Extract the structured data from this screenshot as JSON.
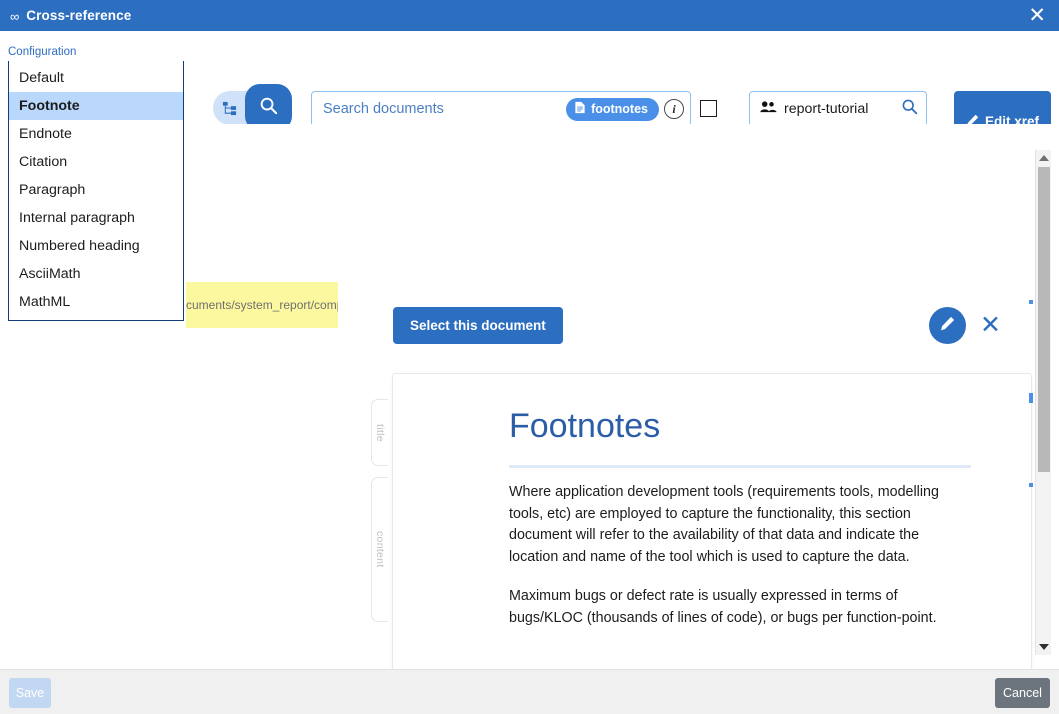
{
  "window": {
    "title": "Cross-reference",
    "icon": "link-infinity-icon",
    "close_label": "✕"
  },
  "toolbar": {
    "config_label": "Configuration",
    "config_value": "Footnote",
    "config_options": [
      "Default",
      "Footnote",
      "Endnote",
      "Citation",
      "Paragraph",
      "Internal paragraph",
      "Numbered heading",
      "AsciiMath",
      "MathML"
    ],
    "config_selected_index": 1,
    "tree_button_name": "document-tree-icon",
    "search_button_name": "search-icon",
    "search_placeholder": "Search documents",
    "search_value": "",
    "chip_label": "footnotes",
    "info_label": "i",
    "project_value": "report-tutorial",
    "edit_xref_label": "Edit xref"
  },
  "main": {
    "highlight_path": "cuments/system_report/comp",
    "select_document_label": "Select this document",
    "section_tags": [
      "title",
      "content"
    ],
    "document": {
      "title": "Footnotes",
      "paragraphs": [
        "Where application development tools (requirements tools, modelling tools, etc) are employed to capture the functionality, this section document will refer to the availability of that data and indicate the location and name of the tool which is used to capture the data.",
        "Maximum bugs or defect rate is usually expressed in terms of bugs/KLOC (thousands of lines of code), or bugs per function-point."
      ]
    }
  },
  "footer": {
    "save_label": "Save",
    "cancel_label": "Cancel"
  },
  "colors": {
    "brand_blue": "#2c6ec0",
    "chip_blue": "#4a90e8",
    "highlight_yellow": "#fcf8a0",
    "selected_row": "#b9d8fb",
    "doc_title_blue": "#2c5ea8",
    "cancel_gray": "#6c757d"
  }
}
